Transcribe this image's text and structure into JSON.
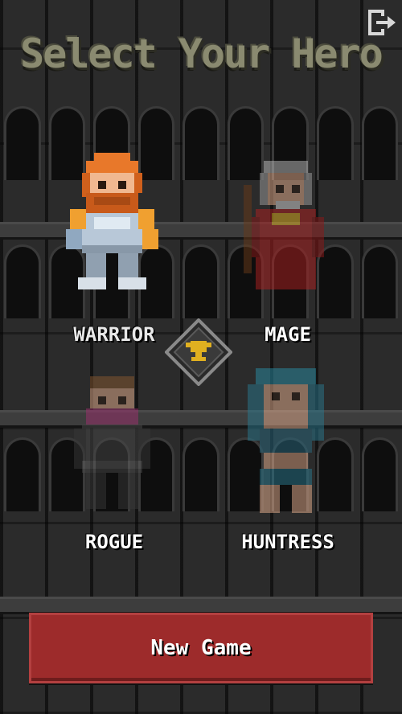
{
  "title": "Select Your Hero",
  "heroes": {
    "warrior": "WARRIOR",
    "mage": "MAGE",
    "rogue": "ROGUE",
    "huntress": "HUNTRESS"
  },
  "new_game_label": "New Game",
  "selected_hero": "warrior",
  "icons": {
    "exit": "exit-icon",
    "badges": "trophy-icon"
  },
  "colors": {
    "title": "#8a8a70",
    "button": "#9d2b2b",
    "trophy": "#e0b020"
  }
}
